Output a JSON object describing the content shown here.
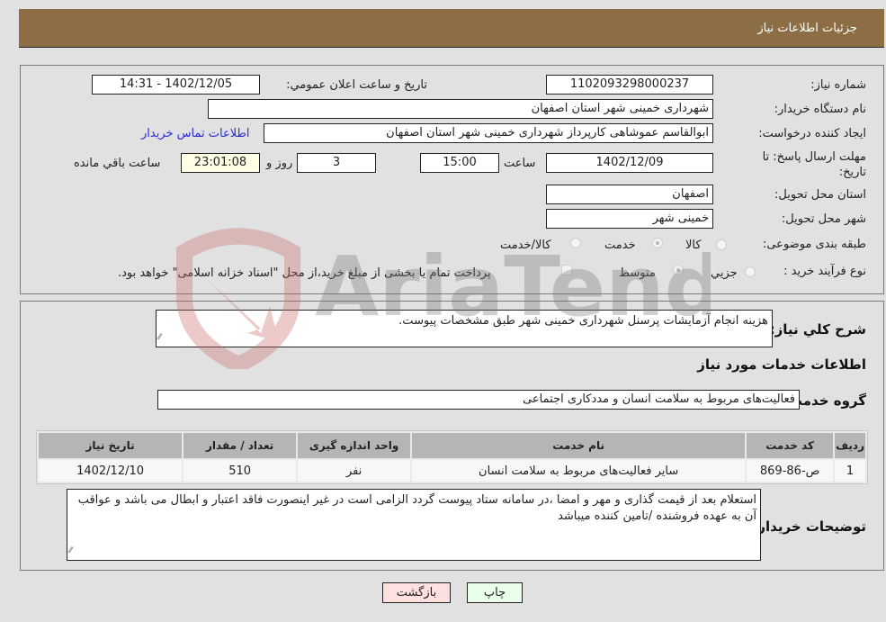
{
  "header": {
    "title": "جزئیات اطلاعات نیاز"
  },
  "form": {
    "need_number": {
      "label": "شماره نیاز:",
      "value": "1102093298000237"
    },
    "announce_datetime": {
      "label": "تاریخ و ساعت اعلان عمومي:",
      "value": "1402/12/05 - 14:31"
    },
    "buyer_org": {
      "label": "نام دستگاه خریدار:",
      "value": "شهرداری خمینی شهر استان اصفهان"
    },
    "requester": {
      "label": "ایجاد کننده درخواست:",
      "value": "ابوالقاسم عموشاهی کارپرداز شهرداری خمینی شهر استان اصفهان"
    },
    "buyer_contact_link": "اطلاعات تماس خریدار",
    "deadline": {
      "label": "مهلت ارسال پاسخ: تا تاریخ:",
      "date": "1402/12/09",
      "time_label": "ساعت",
      "time": "15:00",
      "days": "3",
      "days_label": "روز و",
      "remaining": "23:01:08",
      "remaining_label": "ساعت باقي مانده"
    },
    "delivery_province": {
      "label": "استان محل تحویل:",
      "value": "اصفهان"
    },
    "delivery_city": {
      "label": "شهر محل تحویل:",
      "value": "خمینی شهر"
    },
    "category": {
      "label": "طبقه بندی موضوعی:",
      "options": [
        {
          "label": "کالا",
          "checked": false
        },
        {
          "label": "خدمت",
          "checked": true
        },
        {
          "label": "کالا/خدمت",
          "checked": false
        }
      ]
    },
    "purchase_type": {
      "label": "نوع فرآیند خرید :",
      "options": [
        {
          "label": "جزيي",
          "checked": false
        },
        {
          "label": "متوسط",
          "checked": true
        }
      ],
      "treasury_note": "پرداخت تمام یا بخشی از مبلغ خرید،از محل \"اسناد خزانه اسلامی\" خواهد بود."
    }
  },
  "details": {
    "description_label": "شرح کلي نیاز:",
    "description": "هزینه انجام آزمایشات پرسنل شهرداری خمینی شهر طبق مشخصات پیوست.",
    "services_heading": "اطلاعات خدمات مورد نیاز",
    "service_group_label": "گروه خدمت:",
    "service_group": "فعالیت‌های مربوط به سلامت انسان و مددکاری اجتماعی",
    "table": {
      "headers": [
        "ردیف",
        "کد خدمت",
        "نام خدمت",
        "واحد اندازه گیری",
        "تعداد / مقدار",
        "تاریخ نیاز"
      ],
      "rows": [
        [
          "1",
          "ص-86-869",
          "سایر فعالیت‌های مربوط به سلامت انسان",
          "نفر",
          "510",
          "1402/12/10"
        ]
      ]
    },
    "buyer_notes_label": "توضیحات خریدار:",
    "buyer_notes": "استعلام بعد از قیمت گذاری و مهر و امضا ،در سامانه ستاد پیوست گردد الزامی است در غیر اینصورت فاقد اعتبار و ابطال می باشد و عواقب آن به عهده فروشنده /تامین کننده میباشد"
  },
  "buttons": {
    "print": "چاپ",
    "back": "بازگشت"
  },
  "watermark": {
    "text": "AriaTender.neT"
  },
  "colors": {
    "header_bg": "#8d6d43",
    "page_bg": "#e1e1e1",
    "link": "#2b2bd6",
    "back_btn": "#ffe0e0",
    "print_btn": "#eaffe9"
  }
}
